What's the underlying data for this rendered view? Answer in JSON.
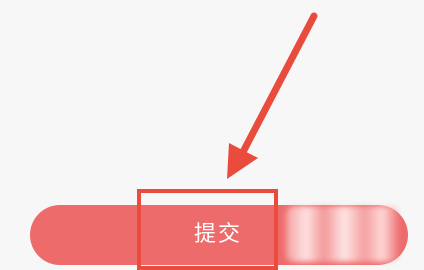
{
  "submit_button": {
    "label": "提交",
    "color": "#ee6b6b"
  },
  "annotation": {
    "color": "#e94c3d",
    "arrow_icon": "arrow-down-left-icon"
  }
}
